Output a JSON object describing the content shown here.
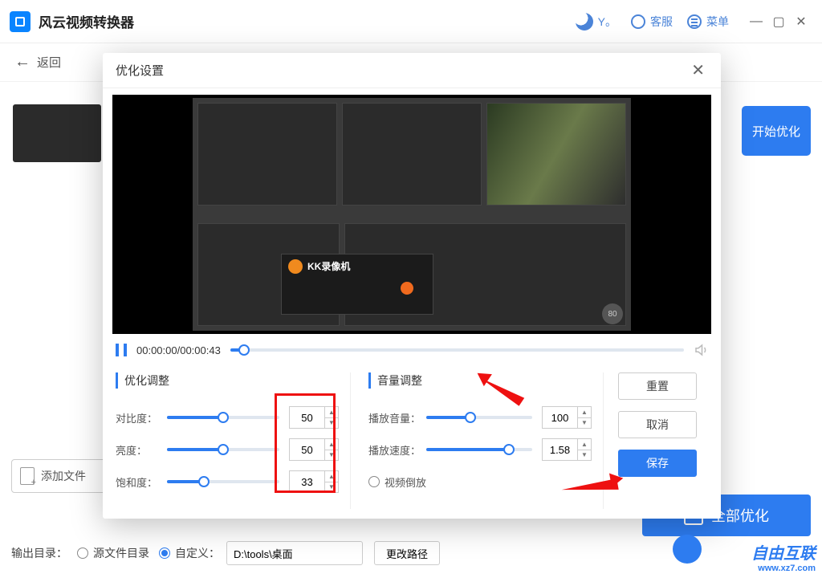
{
  "app": {
    "title": "风云视频转换器",
    "user": "Y。"
  },
  "titlebar": {
    "support": "客服",
    "menu": "菜单"
  },
  "back": {
    "label": "返回"
  },
  "side": {
    "start": "开始优化"
  },
  "modal": {
    "title": "优化设置",
    "time": "00:00:00/00:00:43",
    "kk": "KK录像机",
    "badge": "80",
    "left_title": "优化调整",
    "right_title": "音量调整",
    "contrast_label": "对比度：",
    "contrast_val": "50",
    "brightness_label": "亮度：",
    "brightness_val": "50",
    "saturation_label": "饱和度：",
    "saturation_val": "33",
    "volume_label": "播放音量：",
    "volume_val": "100",
    "speed_label": "播放速度：",
    "speed_val": "1.58",
    "reverse_label": "视频倒放",
    "reset": "重置",
    "cancel": "取消",
    "save": "保存"
  },
  "bottom": {
    "addfile": "添加文件",
    "optimize_all": "全部优化",
    "output_label": "输出目录：",
    "src_dir": "源文件目录",
    "custom": "自定义：",
    "path": "D:\\tools\\桌面",
    "change": "更改路径"
  },
  "watermark": {
    "brand": "自由互联",
    "url": "www.xz7.com"
  }
}
